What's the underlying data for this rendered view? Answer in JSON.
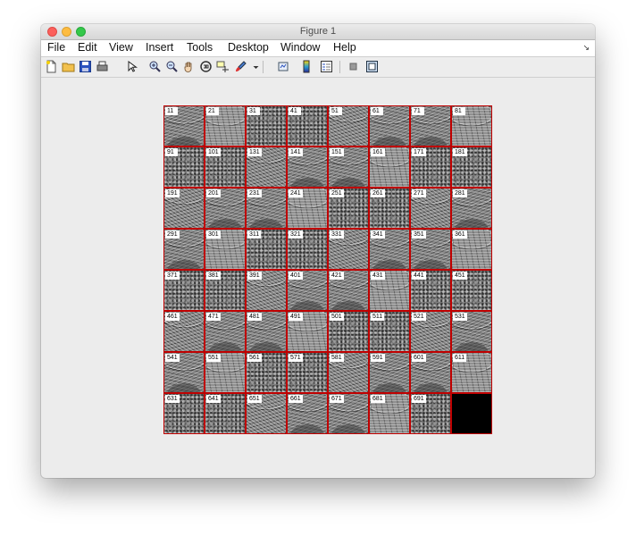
{
  "window": {
    "title": "Figure 1"
  },
  "menu": [
    "File",
    "Edit",
    "View",
    "Insert",
    "Tools",
    "Desktop",
    "Window",
    "Help"
  ],
  "toolbar": {
    "icons": [
      "new-file-icon",
      "open-folder-icon",
      "save-icon",
      "print-icon",
      "pointer-arrow-icon",
      "zoom-in-icon",
      "zoom-out-icon",
      "pan-hand-icon",
      "rotate-3d-icon",
      "data-cursor-icon",
      "brush-icon",
      "dropdown-arrow-icon",
      "link-plot-icon",
      "colorbar-icon",
      "legend-icon",
      "hide-plot-tools-icon",
      "show-plot-tools-icon"
    ]
  },
  "figure": {
    "labels": [
      "11",
      "21",
      "31",
      "41",
      "51",
      "61",
      "71",
      "81",
      "91",
      "101",
      "131",
      "141",
      "151",
      "161",
      "171",
      "181",
      "191",
      "201",
      "231",
      "241",
      "251",
      "261",
      "271",
      "281",
      "291",
      "301",
      "311",
      "321",
      "331",
      "341",
      "351",
      "361",
      "371",
      "381",
      "391",
      "401",
      "421",
      "431",
      "441",
      "451",
      "461",
      "471",
      "481",
      "491",
      "501",
      "511",
      "521",
      "531",
      "541",
      "551",
      "561",
      "571",
      "581",
      "591",
      "601",
      "611",
      "631",
      "641",
      "651",
      "661",
      "671",
      "681",
      "691",
      ""
    ],
    "colors": {
      "cell_border": "#c00000",
      "blank_cell": "#000000"
    }
  }
}
